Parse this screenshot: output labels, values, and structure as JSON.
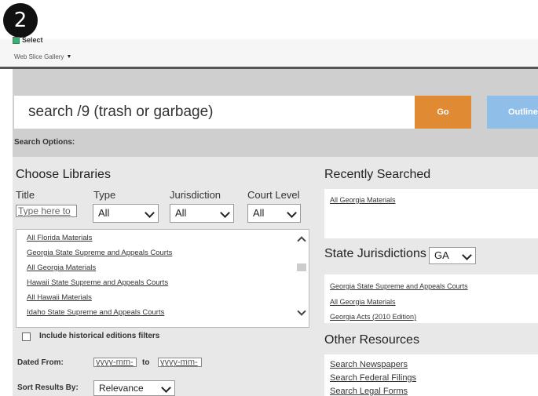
{
  "step_badge": "2",
  "toolbar": {
    "select_label": "Select",
    "gallery_label": "Web Slice Gallery"
  },
  "search": {
    "query": "search /9 (trash or garbage)",
    "go_label": "Go",
    "outline_label": "Outline"
  },
  "search_options_label": "Search Options:",
  "libraries": {
    "title": "Choose Libraries",
    "columns": [
      "Title",
      "Type",
      "Jurisdiction",
      "Court Level"
    ],
    "title_placeholder": "Type here to",
    "type_value": "All",
    "jurisdiction_value": "All",
    "court_value": "All",
    "items": [
      "All Florida Materials",
      "Georgia State Supreme and Appeals Courts",
      "All Georgia Materials",
      "Hawaii State Supreme and Appeals Courts",
      "All Hawaii Materials",
      "Idaho State Supreme and Appeals Courts"
    ]
  },
  "historical_label": "Include historical editions filters",
  "dated": {
    "label": "Dated From:",
    "from": "yyyy-mm-",
    "to_label": "to",
    "to": "yyyy-mm-"
  },
  "sort": {
    "label": "Sort Results By:",
    "value": "Relevance"
  },
  "recent": {
    "title": "Recently Searched",
    "items": [
      "All Georgia Materials"
    ]
  },
  "state": {
    "title": "State Jurisdictions",
    "value": "GA",
    "items": [
      "Georgia State Supreme and Appeals Courts",
      "All Georgia Materials",
      "Georgia Acts (2010 Edition)"
    ]
  },
  "other": {
    "title": "Other Resources",
    "items": [
      "Search Newspapers",
      "Search Federal Filings",
      "Search Legal Forms"
    ]
  }
}
